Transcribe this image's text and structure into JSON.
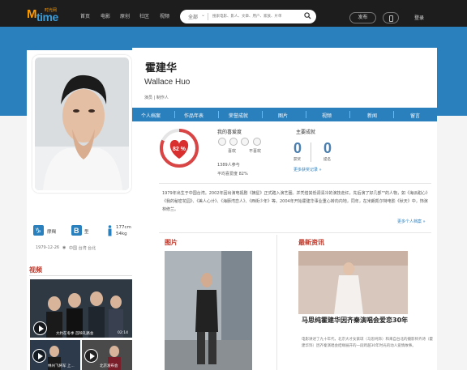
{
  "logo": {
    "brand_cn": "时光网",
    "brand_m": "M",
    "brand_time": "time"
  },
  "nav": {
    "items": [
      "首页",
      "电影",
      "原创",
      "社区",
      "视频"
    ]
  },
  "search": {
    "category": "全部",
    "placeholder": "搜索电影、影人、文章、用户、家族、片单"
  },
  "header_actions": {
    "publish": "发布",
    "login": "登录"
  },
  "person": {
    "name_cn": "霍建华",
    "name_en": "Wallace Huo",
    "roles": "演员 | 制作人"
  },
  "tabs": [
    "个人档案",
    "作品年表",
    "荣誉成就",
    "图片",
    "视频",
    "新闻",
    "留言"
  ],
  "rating": {
    "score": "82 %",
    "score_value": 82,
    "my_like_label": "我的喜爱度",
    "like": "喜欢",
    "dislike": "不喜欢",
    "votes": "1389人参与",
    "avg": "平均喜爱度 82%"
  },
  "achievements": {
    "title": "主要成就",
    "wins": "0",
    "wins_label": "获奖",
    "noms": "0",
    "noms_label": "提名",
    "more": "更多获奖记录 »"
  },
  "bio": {
    "text": "1979年出生于中国台湾。2002年因出演电视剧《摘星》正式踏入演艺圈。并凭借其低调清冷的演技走红，先后演了好几部\"\"的人物，如《海派甜心》《我的秘密花园》、《美人心计》、《海豚湾恋人》、《西街少年》等。2004年开始霍建华事业重心转向内地，同年，在米朗凯尔特电影《秋天》中，饰演林修兰。",
    "more": "更多个人档案 »"
  },
  "facts": {
    "zodiac": "摩羯",
    "blood": "B",
    "blood_suffix": "型",
    "height": "177cm",
    "weight": "54kg",
    "birth": "1979-12-26",
    "birthplace": "中国 台湾 台北"
  },
  "video": {
    "title": "视频",
    "items": [
      {
        "caption": "大约在冬季 首映礼路会",
        "duration": "02:14"
      },
      {
        "caption": "林州飞将军 上..."
      },
      {
        "caption": "北京发布会"
      }
    ]
  },
  "photos": {
    "title": "图片"
  },
  "news": {
    "title": "最新资讯",
    "headline": "马思纯霍建华因齐秦演唱会爱恋30年",
    "body": "电影讲述了九十年代，北京大才女紫琼（马思纯饰）和来自台北的摄影师齐诗（霍建华饰）因齐秦演唱会结缘展开的一段跨越30年时光的动人爱情故事。"
  },
  "colors": {
    "accent": "#2a7fbd",
    "red": "#c0392b",
    "nav": "#1d1d1d"
  }
}
